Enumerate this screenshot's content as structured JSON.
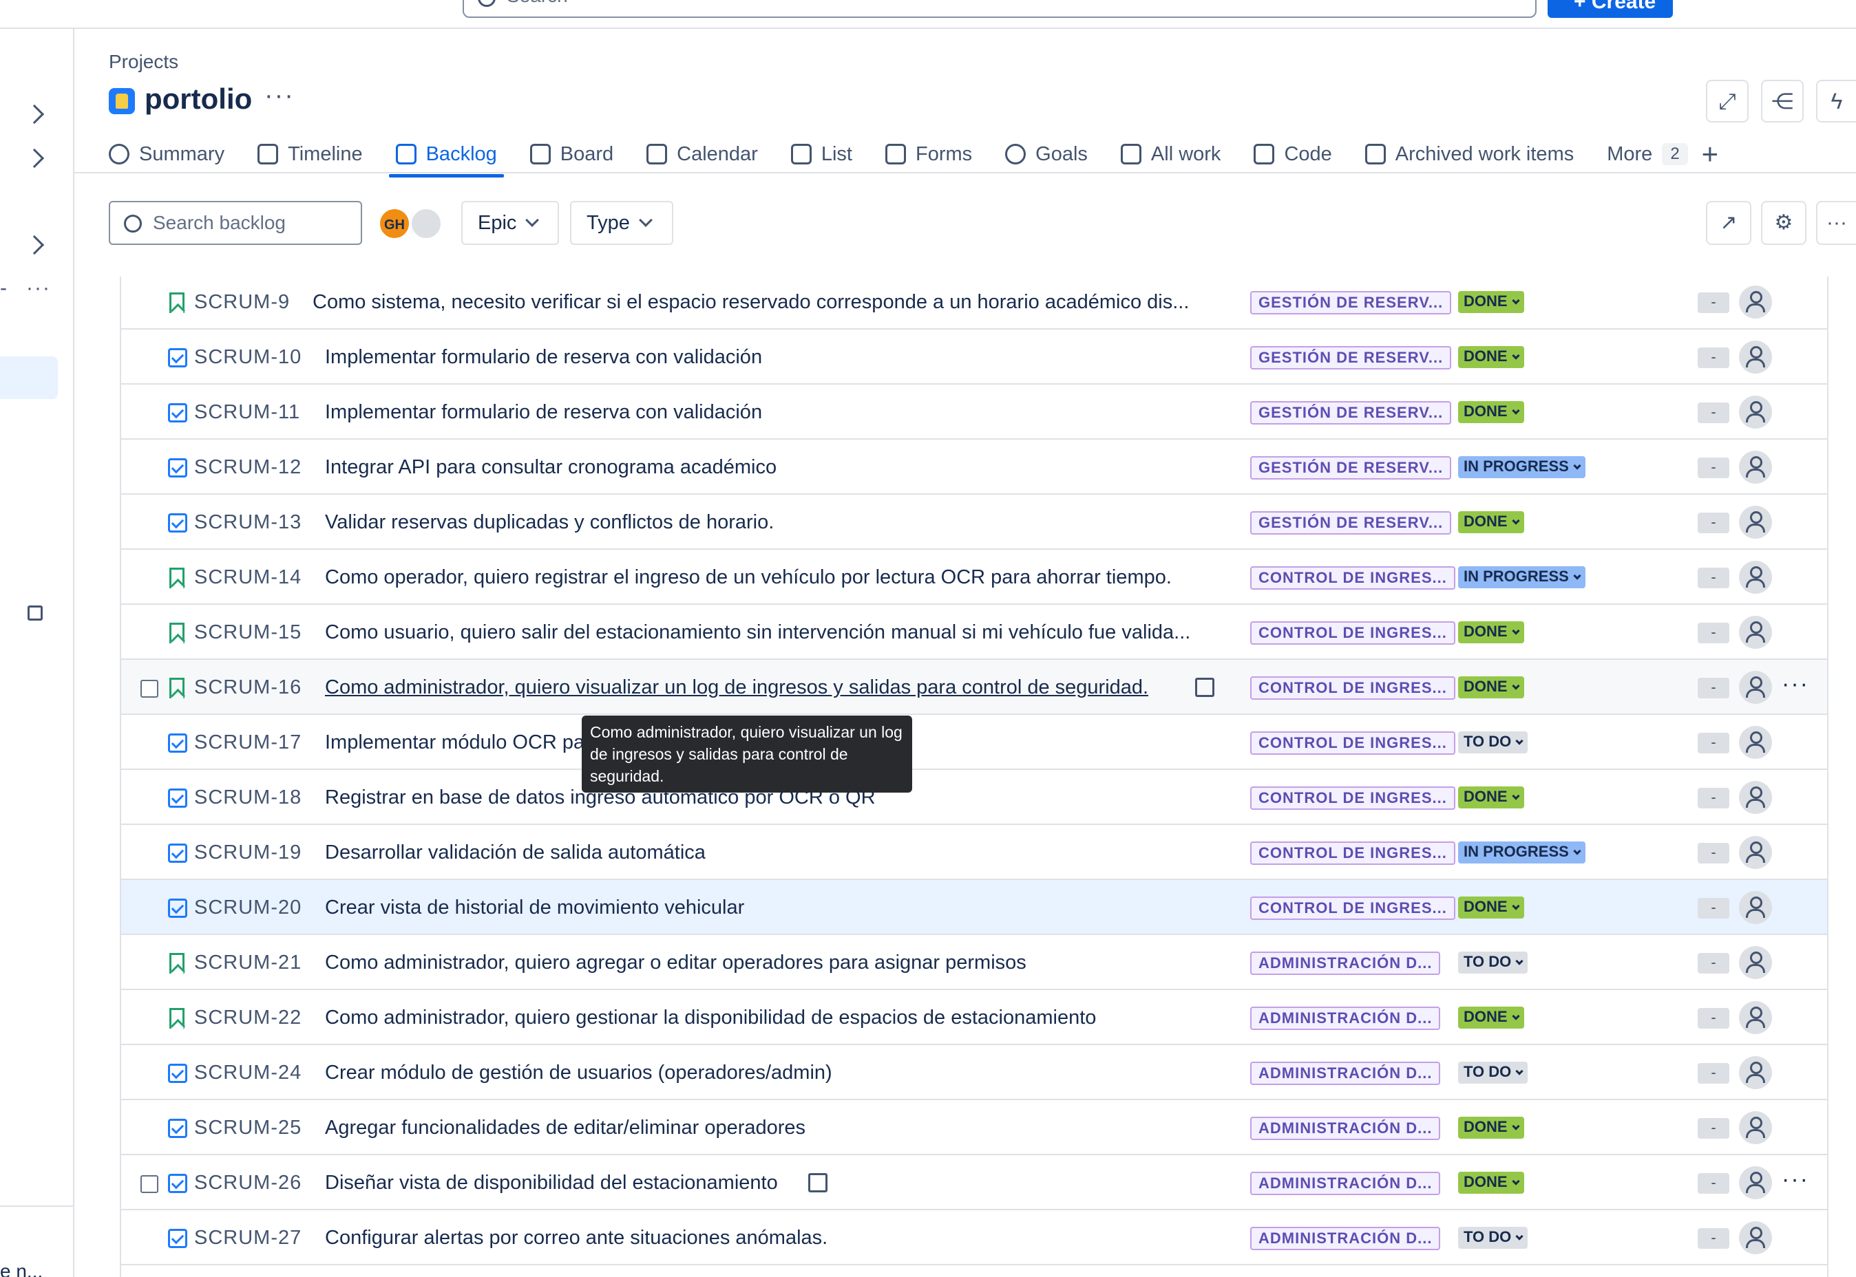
{
  "topbar": {
    "search_placeholder": "Search",
    "create_label": "+ Create"
  },
  "sidebar": {
    "bottom_text": "e n..."
  },
  "header": {
    "breadcrumb": "Projects",
    "project_name": "portolio",
    "more": "···"
  },
  "tabs": [
    {
      "label": "Summary",
      "icon": "globe-icon"
    },
    {
      "label": "Timeline",
      "icon": "timeline-icon"
    },
    {
      "label": "Backlog",
      "icon": "backlog-icon",
      "active": true
    },
    {
      "label": "Board",
      "icon": "board-icon"
    },
    {
      "label": "Calendar",
      "icon": "calendar-icon"
    },
    {
      "label": "List",
      "icon": "list-icon"
    },
    {
      "label": "Forms",
      "icon": "forms-icon"
    },
    {
      "label": "Goals",
      "icon": "goals-icon"
    },
    {
      "label": "All work",
      "icon": "all-work-icon"
    },
    {
      "label": "Code",
      "icon": "code-icon"
    },
    {
      "label": "Archived work items",
      "icon": "archive-icon"
    }
  ],
  "tabs_more": {
    "label": "More",
    "count": "2"
  },
  "toolbar": {
    "search_placeholder": "Search backlog",
    "avatar_initials": "GH",
    "epic_filter": "Epic",
    "type_filter": "Type"
  },
  "tooltip": {
    "text": "Como administrador, quiero visualizar un log de ingresos y salidas para control de seguridad."
  },
  "issues": [
    {
      "key": "SCRUM-9",
      "type": "story",
      "summary": "Como sistema, necesito verificar si el espacio reservado corresponde a un horario académico dis...",
      "epic": "GESTIÓN DE RESERV...",
      "status": "DONE",
      "estimate": "-"
    },
    {
      "key": "SCRUM-10",
      "type": "task",
      "summary": "Implementar formulario de reserva con validación",
      "epic": "GESTIÓN DE RESERV...",
      "status": "DONE",
      "estimate": "-"
    },
    {
      "key": "SCRUM-11",
      "type": "task",
      "summary": "Implementar formulario de reserva con validación",
      "epic": "GESTIÓN DE RESERV...",
      "status": "DONE",
      "estimate": "-"
    },
    {
      "key": "SCRUM-12",
      "type": "task",
      "summary": "Integrar API para consultar cronograma académico",
      "epic": "GESTIÓN DE RESERV...",
      "status": "IN PROGRESS",
      "estimate": "-"
    },
    {
      "key": "SCRUM-13",
      "type": "task",
      "summary": "Validar reservas duplicadas y conflictos de horario.",
      "epic": "GESTIÓN DE RESERV...",
      "status": "DONE",
      "estimate": "-"
    },
    {
      "key": "SCRUM-14",
      "type": "story",
      "summary": "Como operador, quiero registrar el ingreso de un vehículo por lectura OCR para ahorrar tiempo.",
      "epic": "CONTROL DE INGRES...",
      "status": "IN PROGRESS",
      "estimate": "-"
    },
    {
      "key": "SCRUM-15",
      "type": "story",
      "summary": "Como usuario, quiero salir del estacionamiento sin intervención manual si mi vehículo fue valida...",
      "epic": "CONTROL DE INGRES...",
      "status": "DONE",
      "estimate": "-"
    },
    {
      "key": "SCRUM-16",
      "type": "story",
      "summary": "Como administrador, quiero visualizar un log de ingresos y salidas para control de seguridad.",
      "epic": "CONTROL DE INGRES...",
      "status": "DONE",
      "estimate": "-"
    },
    {
      "key": "SCRUM-17",
      "type": "task",
      "summary": "Implementar módulo OCR pa",
      "epic": "CONTROL DE INGRES...",
      "status": "TO DO",
      "estimate": "-"
    },
    {
      "key": "SCRUM-18",
      "type": "task",
      "summary": "Registrar en base de datos ingreso automático por OCR o QR",
      "epic": "CONTROL DE INGRES...",
      "status": "DONE",
      "estimate": "-"
    },
    {
      "key": "SCRUM-19",
      "type": "task",
      "summary": "Desarrollar validación de salida automática",
      "epic": "CONTROL DE INGRES...",
      "status": "IN PROGRESS",
      "estimate": "-"
    },
    {
      "key": "SCRUM-20",
      "type": "task",
      "summary": "Crear vista de historial de movimiento vehicular",
      "epic": "CONTROL DE INGRES...",
      "status": "DONE",
      "estimate": "-"
    },
    {
      "key": "SCRUM-21",
      "type": "story",
      "summary": "Como administrador, quiero agregar o editar operadores para asignar permisos",
      "epic": "ADMINISTRACIÓN D...",
      "status": "TO DO",
      "estimate": "-"
    },
    {
      "key": "SCRUM-22",
      "type": "story",
      "summary": "Como administrador, quiero gestionar la disponibilidad de espacios de estacionamiento",
      "epic": "ADMINISTRACIÓN D...",
      "status": "DONE",
      "estimate": "-"
    },
    {
      "key": "SCRUM-24",
      "type": "task",
      "summary": "Crear módulo de gestión de usuarios (operadores/admin)",
      "epic": "ADMINISTRACIÓN D...",
      "status": "TO DO",
      "estimate": "-"
    },
    {
      "key": "SCRUM-25",
      "type": "task",
      "summary": "Agregar funcionalidades de editar/eliminar operadores",
      "epic": "ADMINISTRACIÓN D...",
      "status": "DONE",
      "estimate": "-"
    },
    {
      "key": "SCRUM-26",
      "type": "task",
      "summary": "Diseñar vista de disponibilidad del estacionamiento",
      "epic": "ADMINISTRACIÓN D...",
      "status": "DONE",
      "estimate": "-"
    },
    {
      "key": "SCRUM-27",
      "type": "task",
      "summary": "Configurar alertas por correo ante situaciones anómalas.",
      "epic": "ADMINISTRACIÓN D...",
      "status": "TO DO",
      "estimate": "-"
    }
  ],
  "colors": {
    "accent": "#0c66e4",
    "done": "#94c748",
    "in_progress": "#8fb8f6",
    "todo": "#dcdfe4",
    "epic_text": "#5e4db2",
    "story_icon": "#22a06b",
    "task_icon": "#1d7afc"
  }
}
